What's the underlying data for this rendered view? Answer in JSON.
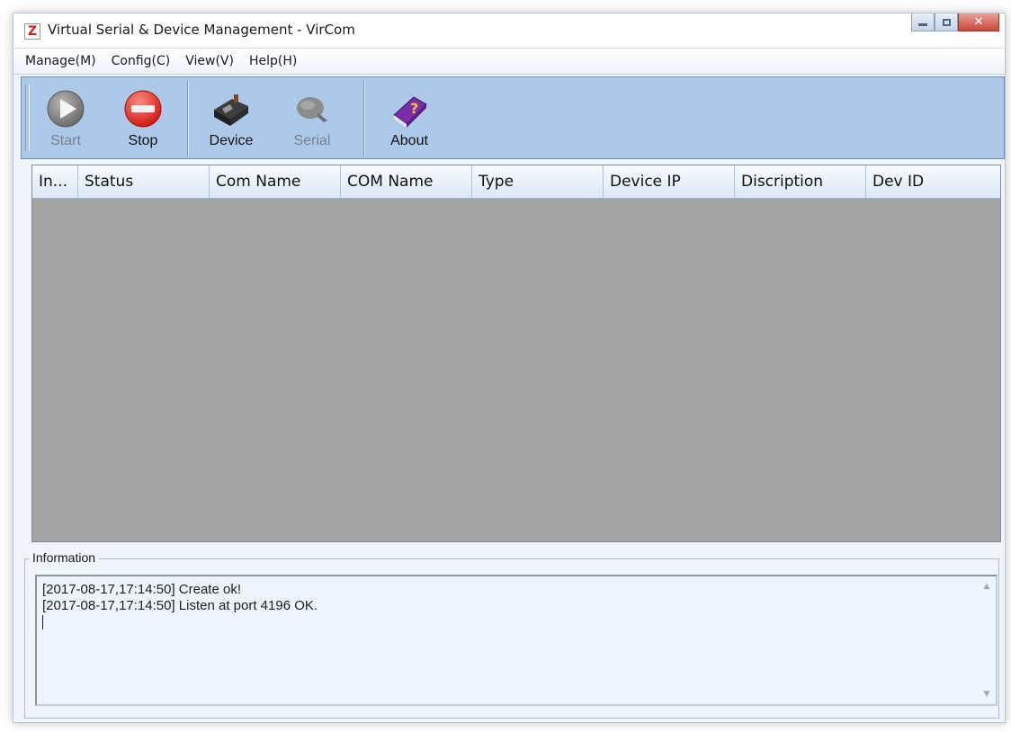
{
  "window": {
    "title": "Virtual Serial & Device Management - VirCom",
    "logo_letter": "Z",
    "controls": [
      "minimize",
      "maximize",
      "close"
    ]
  },
  "menu": [
    {
      "label": "Manage(M)"
    },
    {
      "label": "Config(C)"
    },
    {
      "label": "View(V)"
    },
    {
      "label": "Help(H)"
    }
  ],
  "toolbar": {
    "start_label": "Start",
    "stop_label": "Stop",
    "device_label": "Device",
    "serial_label": "Serial",
    "about_label": "About",
    "start_enabled": false,
    "serial_enabled": false,
    "icons": {
      "start": "play-icon",
      "stop": "stop-icon",
      "device": "device-icon",
      "serial": "serial-icon",
      "about": "help-book-icon"
    }
  },
  "list": {
    "columns": [
      "In...",
      "Status",
      "Com Name",
      "COM Name",
      "Type",
      "Device IP",
      "Discription",
      "Dev ID"
    ],
    "rows": []
  },
  "info": {
    "legend": "Information",
    "log": [
      "[2017-08-17,17:14:50] Create ok!",
      "[2017-08-17,17:14:50] Listen at port 4196 OK."
    ]
  },
  "colors": {
    "toolbar_bg": "#adc9ea",
    "list_bg": "#a4a4a4",
    "log_bg": "#edf4fd",
    "stop_red": "#e8322b",
    "about_purple": "#7a2ea8"
  }
}
